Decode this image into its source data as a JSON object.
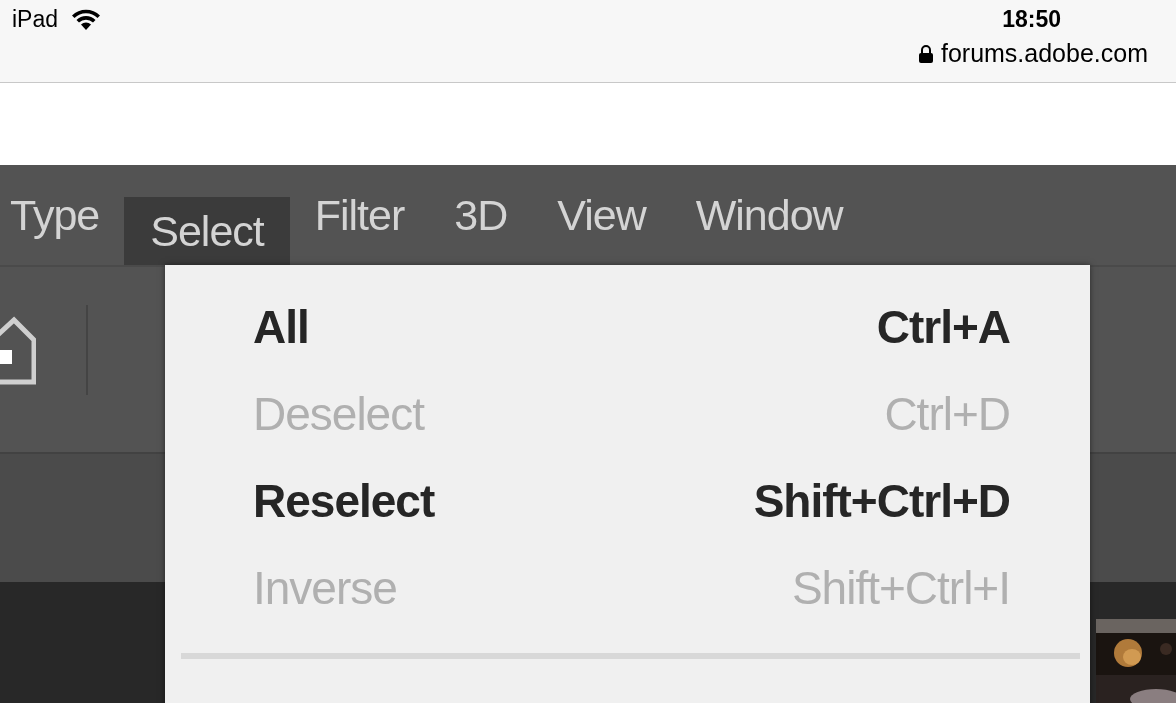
{
  "status_bar": {
    "device": "iPad",
    "time": "18:50",
    "url": "forums.adobe.com"
  },
  "menubar": [
    {
      "label": "Type",
      "selected": false
    },
    {
      "label": "Select",
      "selected": true
    },
    {
      "label": "Filter",
      "selected": false
    },
    {
      "label": "3D",
      "selected": false
    },
    {
      "label": "View",
      "selected": false
    },
    {
      "label": "Window",
      "selected": false
    }
  ],
  "menu": {
    "items": [
      {
        "label": "All",
        "shortcut": "Ctrl+A",
        "disabled": false
      },
      {
        "label": "Deselect",
        "shortcut": "Ctrl+D",
        "disabled": true
      },
      {
        "label": "Reselect",
        "shortcut": "Shift+Ctrl+D",
        "disabled": false
      },
      {
        "label": "Inverse",
        "shortcut": "Shift+Ctrl+I",
        "disabled": true
      }
    ]
  }
}
